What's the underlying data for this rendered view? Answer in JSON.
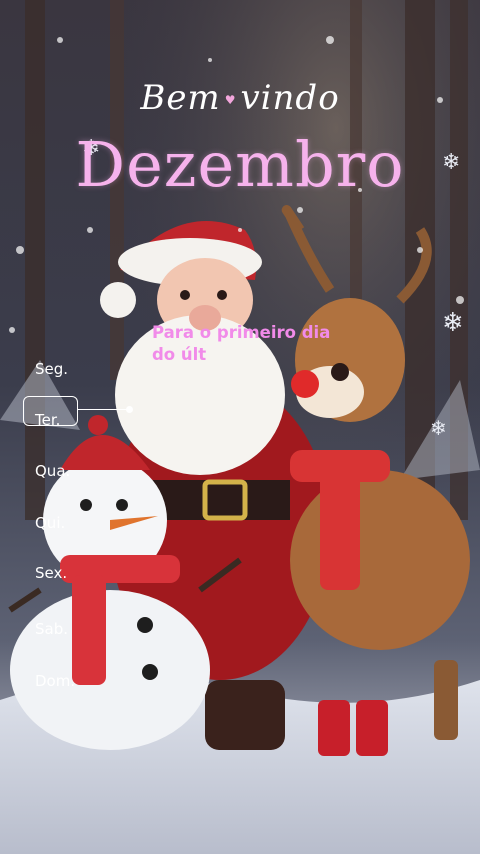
{
  "header": {
    "welcome_part1": "Bem",
    "welcome_part2": "vindo",
    "month": "Dezembro"
  },
  "caption": {
    "line1": "Para o primeiro dia",
    "line2": "do últ"
  },
  "days": {
    "items": [
      "Seg.",
      "Ter.",
      "Qua.",
      "Qui.",
      "Sex.",
      "Sab.",
      "Dom."
    ],
    "selected": "Ter."
  },
  "colors": {
    "title_pink": "#f6b2ec",
    "caption_pink": "#f18be9",
    "text_white": "#ffffff"
  }
}
